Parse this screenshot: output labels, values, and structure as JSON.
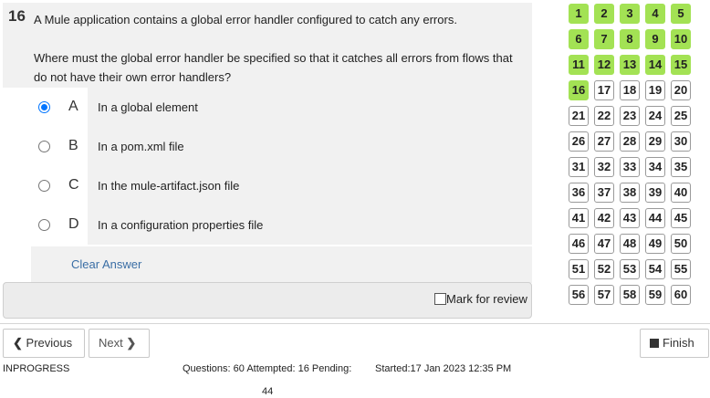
{
  "question": {
    "number": "16",
    "text": "A Mule application contains a global error handler configured to catch any errors.\n\nWhere must the global error handler be specified so that it catches all errors from flows that do not have their own error handlers?"
  },
  "options": [
    {
      "letter": "A",
      "text": "In a global element",
      "selected": true
    },
    {
      "letter": "B",
      "text": "In a pom.xml file",
      "selected": false
    },
    {
      "letter": "C",
      "text": "In the mule-artifact.json file",
      "selected": false
    },
    {
      "letter": "D",
      "text": "In a configuration properties file",
      "selected": false
    }
  ],
  "clear_label": "Clear Answer",
  "review_label": "Mark for review",
  "grid": {
    "numbers": [
      "1",
      "2",
      "3",
      "4",
      "5",
      "6",
      "7",
      "8",
      "9",
      "10",
      "11",
      "12",
      "13",
      "14",
      "15",
      "16",
      "17",
      "18",
      "19",
      "20",
      "21",
      "22",
      "23",
      "24",
      "25",
      "26",
      "27",
      "28",
      "29",
      "30",
      "31",
      "32",
      "33",
      "34",
      "35",
      "36",
      "37",
      "38",
      "39",
      "40",
      "41",
      "42",
      "43",
      "44",
      "45",
      "46",
      "47",
      "48",
      "49",
      "50",
      "51",
      "52",
      "53",
      "54",
      "55",
      "56",
      "57",
      "58",
      "59",
      "60"
    ],
    "attempted_count": 16,
    "attempted_color": "#a3e254"
  },
  "footer": {
    "previous_label": "Previous",
    "next_label": "Next",
    "finish_label": "Finish",
    "status": "INPROGRESS",
    "stats": "Questions: 60 Attempted: 16 Pending:",
    "pending_count": "44",
    "started": "Started:17 Jan 2023 12:35 PM"
  }
}
